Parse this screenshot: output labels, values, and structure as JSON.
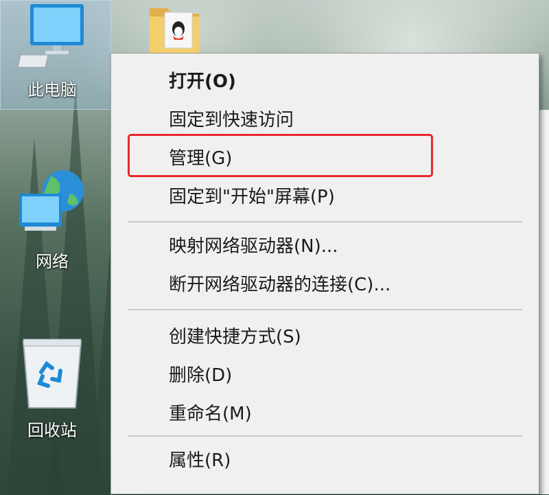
{
  "desktop_icons": [
    {
      "label": "此电脑",
      "icon": "computer-icon"
    },
    {
      "label": "网络",
      "icon": "network-icon"
    },
    {
      "label": "回收站",
      "icon": "recycle-bin-icon"
    }
  ],
  "context_menu": {
    "items": [
      {
        "label": "打开(O)",
        "bold": true
      },
      {
        "label": "固定到快速访问"
      },
      {
        "label": "管理(G)",
        "highlighted": true
      },
      {
        "label": "固定到\"开始\"屏幕(P)"
      },
      {
        "label": "映射网络驱动器(N)..."
      },
      {
        "label": "断开网络驱动器的连接(C)..."
      },
      {
        "label": "创建快捷方式(S)"
      },
      {
        "label": "删除(D)"
      },
      {
        "label": "重命名(M)"
      },
      {
        "label": "属性(R)"
      }
    ]
  },
  "colors": {
    "highlight_box": "#e8272b",
    "menu_bg": "#f0f0f0"
  }
}
